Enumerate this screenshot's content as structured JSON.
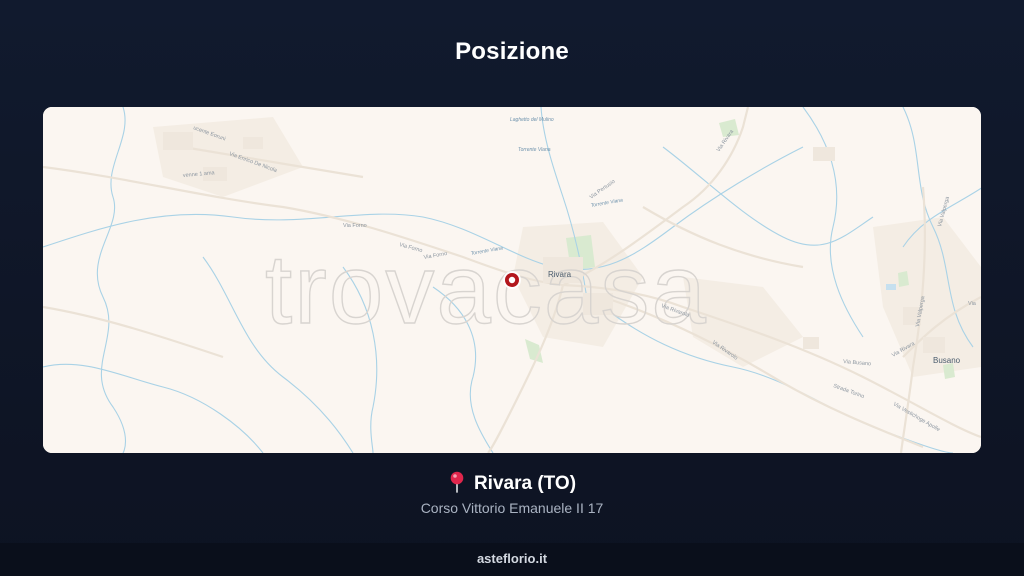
{
  "page": {
    "title": "Posizione"
  },
  "map": {
    "watermark_text": "trovacasa",
    "marker_icon": "map-marker-icon",
    "accent_color": "#b3171d",
    "labels": {
      "town_center": "Rivara",
      "town_east": "Busano",
      "lake": "Laghetto del Mulino",
      "via_enrico_de_nicola": "Via Enrico De Nicola",
      "via_forno_1": "Via Forno",
      "via_forno_2": "Via Forno",
      "via_forno_3": "Via Forno",
      "via_pertusio": "Via Pertusio",
      "via_rivara": "Via Rivara",
      "via_rivarolo_1": "Via Rivarolo",
      "via_rivarolo_2": "Via Rivarolo",
      "via_busano": "Via Busano",
      "strada_torino": "Strada Torino",
      "via_valperga_1": "Via Valperga",
      "via_valperga_2": "Via Valperga",
      "via_vestichoge_apolle": "Via Vestichoge Apolle",
      "via_rivara_east": "Via Rivara",
      "torrente_viana_1": "Torrente Viana",
      "torrente_viana_2": "Torrente Viana",
      "torrente_viana_3": "Torrente Viana",
      "via_edge": "Via",
      "edge_label": "ucente Eoruni",
      "edge_label_2": "venne 1 ama"
    }
  },
  "location": {
    "pin_icon": "round-pushpin-icon",
    "city": "Rivara (TO)",
    "address": "Corso Vittorio Emanuele II 17"
  },
  "footer": {
    "site": "asteflorio.it"
  }
}
